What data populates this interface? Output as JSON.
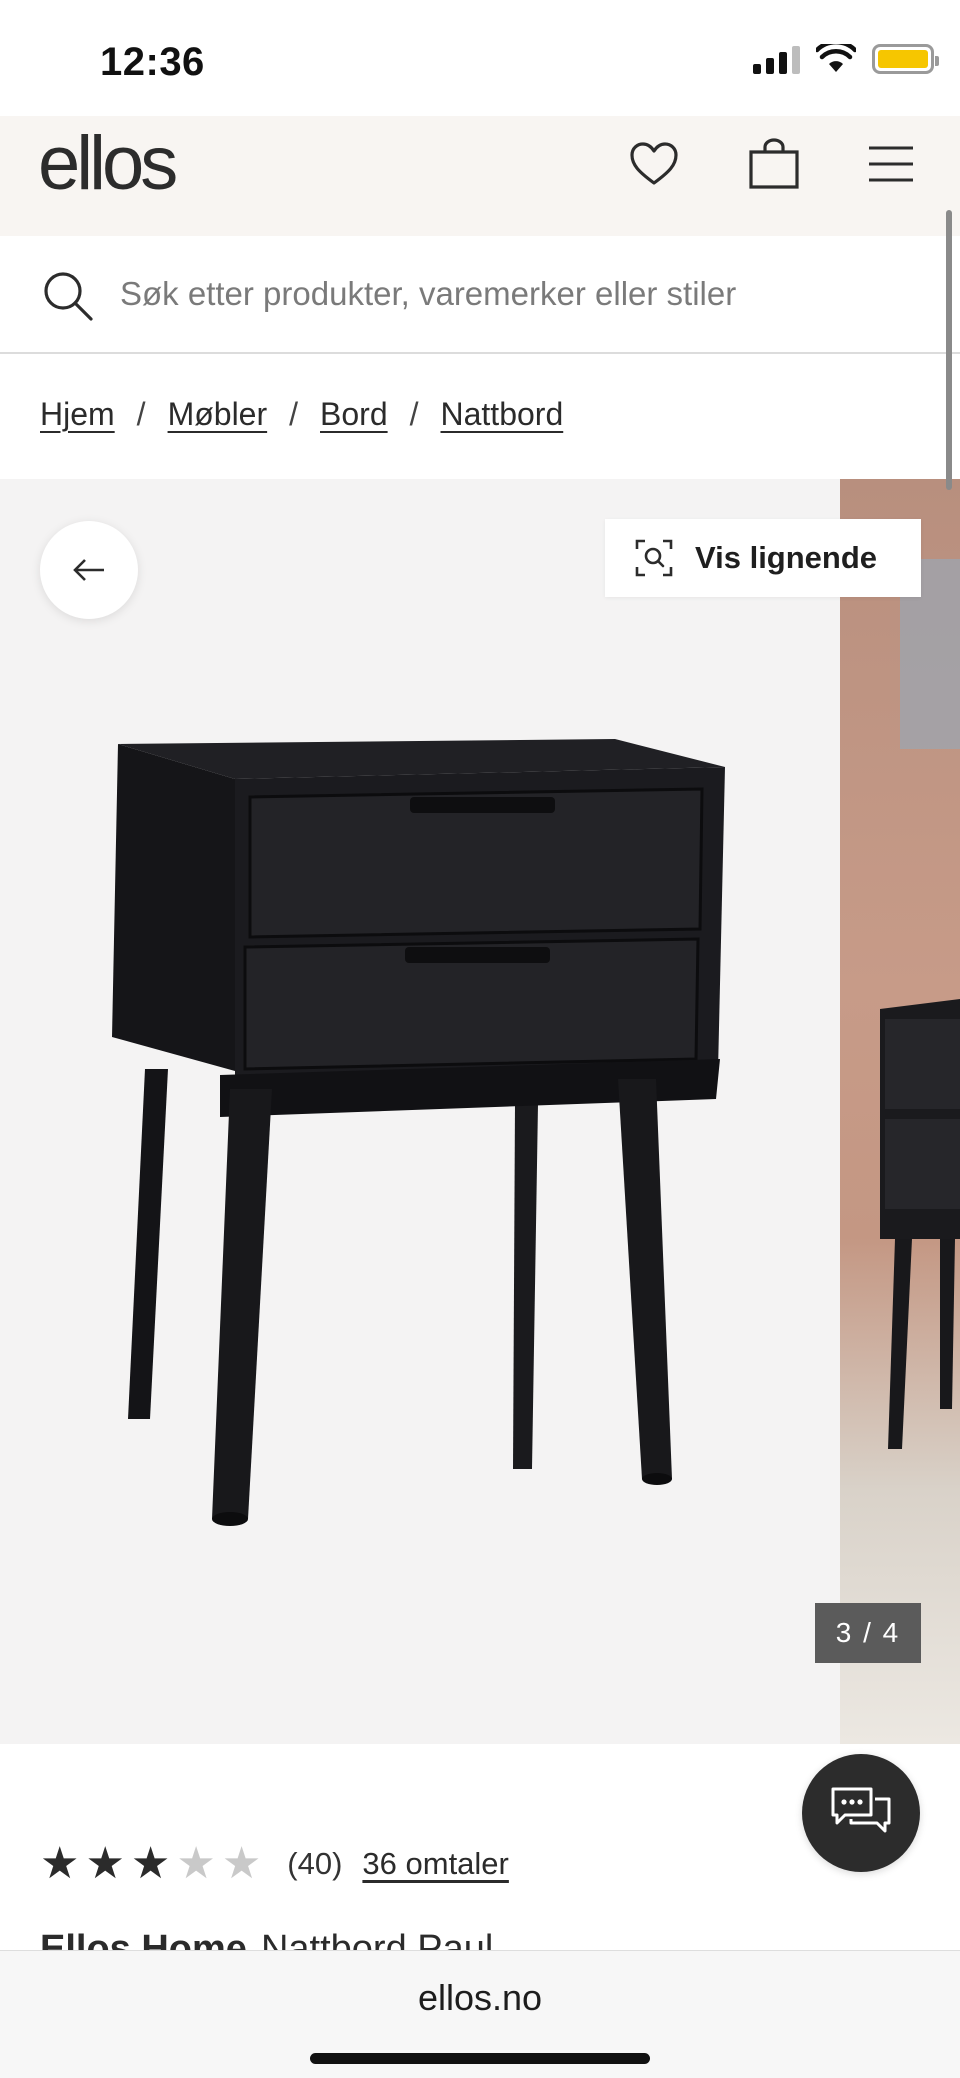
{
  "status_bar": {
    "time": "12:36"
  },
  "header": {
    "logo": "ellos"
  },
  "search": {
    "placeholder": "Søk etter produkter, varemerker eller stiler"
  },
  "breadcrumb": [
    {
      "label": "Hjem"
    },
    {
      "label": "Møbler"
    },
    {
      "label": "Bord"
    },
    {
      "label": "Nattbord"
    }
  ],
  "breadcrumb_separator": "/",
  "gallery": {
    "similar_label": "Vis lignende",
    "counter": "3 / 4",
    "current_image": 3,
    "total_images": 4
  },
  "product": {
    "rating": 3,
    "rating_max": 5,
    "rating_count": "(40)",
    "reviews_link": "36 omtaler",
    "brand": "Ellos Home",
    "name": "Nattbord Paul"
  },
  "browser": {
    "url": "ellos.no"
  },
  "colors": {
    "header_bg": "#f8f5f2",
    "battery": "#f6c600",
    "counter_bg": "#5b5b5b",
    "chat_bg": "#2c2c2c",
    "product_black": "#121215"
  }
}
